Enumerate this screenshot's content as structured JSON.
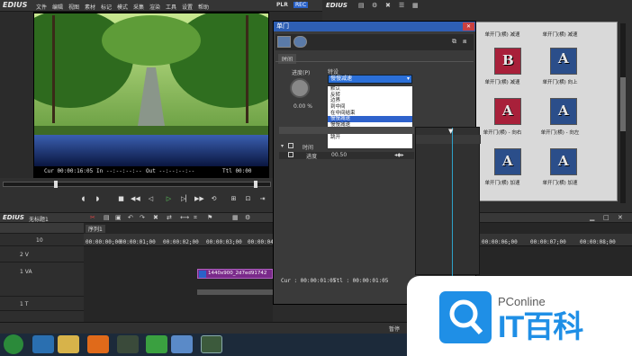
{
  "app": {
    "name": "EDIUS",
    "plr": "PLR",
    "rec": "REC"
  },
  "menu": [
    "文件",
    "编辑",
    "视图",
    "素材",
    "标记",
    "模式",
    "采集",
    "渲染",
    "工具",
    "设置",
    "帮助"
  ],
  "player": {
    "cur": "Cur 00:00:16:05",
    "in": "In --:--:--:--",
    "out": "Out --:--:--:--",
    "ttl": "Ttl 00:00"
  },
  "timeline": {
    "title": "EDIUS",
    "project": "无标题1",
    "sequence": "序列1",
    "tracks": [
      "10",
      "2 V",
      "1 VA",
      "1 T"
    ],
    "ruler": [
      "00:00:00;00",
      "00:00:01;00",
      "00:00:02;00",
      "00:00:03;00",
      "00:00:04;00",
      "00:00:05;00",
      "00:00:06;00",
      "00:00:07;00",
      "00:00:08;00"
    ],
    "clip_label": "1440x900_2d7ed91742"
  },
  "right_panel": {
    "title": "EDIUS",
    "thumbs": [
      {
        "letter": "B",
        "label": "单开门(横) 减速",
        "red": true,
        "small": "AS"
      },
      {
        "letter": "A",
        "label": "单开门(横) 向上",
        "red": false,
        "small": "S"
      },
      {
        "letter": "A",
        "label": "单开门(横) - 向右",
        "red": true,
        "small": "S"
      },
      {
        "letter": "A",
        "label": "单开门(横) - 向左",
        "red": false,
        "small": "S"
      },
      {
        "letter": "A",
        "label": "单开门(横) 加速",
        "red": false,
        "small": "S"
      },
      {
        "letter": "A",
        "label": "单开门(横) 加速",
        "red": false,
        "small": "S"
      }
    ],
    "top_caps": [
      "单开门(横) 减速",
      "单开门(横) 减速"
    ]
  },
  "dialog": {
    "title": "单门",
    "tab": "时间",
    "progress_label": "进度(P)",
    "progress_value": "0.00 %",
    "combo_label": "特设",
    "combo_value": "慢慢减速",
    "options": [
      "默认",
      "反转",
      "边界",
      "到中间",
      "在中间结束",
      "慢慢减速",
      "慢慢减速",
      "减速",
      "跳开"
    ],
    "selected_index": 5,
    "tree_time": "时间",
    "tree_progress": "进度",
    "tree_value": "00.50",
    "cur": "Cur : 00:00:01:05",
    "ttl": "Ttl : 00:00:01:05"
  },
  "status": {
    "pause": "暂停"
  },
  "watermark": {
    "top": "PConline",
    "big": "IT百科"
  }
}
